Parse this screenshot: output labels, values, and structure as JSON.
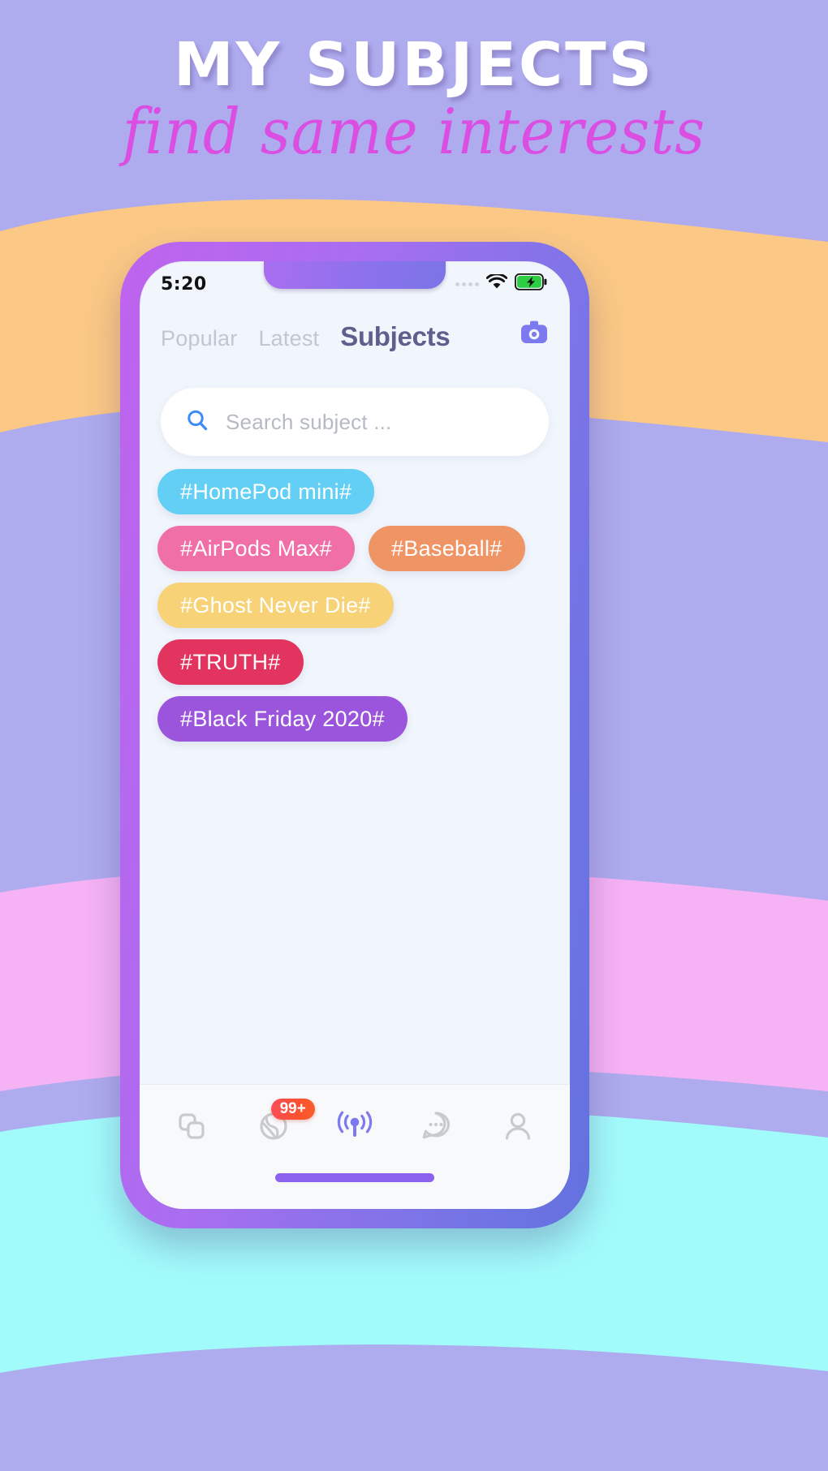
{
  "poster": {
    "title": "MY SUBJECTS",
    "subtitle": "find same interests",
    "title_color": "#ffffff",
    "subtitle_color": "#da4ee2",
    "background_base": "#aeabee",
    "wave_colors": [
      "#fbc985",
      "#f7b0f3",
      "#9bf7f7",
      "#b4b2f0"
    ]
  },
  "phone": {
    "frame_gradient_from": "#bf63ee",
    "frame_gradient_to": "#6272de",
    "screen_bg": "#f1f5fc"
  },
  "statusbar": {
    "time": "5:20",
    "signal_icon": "signal-dots-icon",
    "wifi_icon": "wifi-icon",
    "battery_icon": "battery-charging-icon",
    "battery_color": "#2ece44"
  },
  "topnav": {
    "tabs": [
      {
        "label": "Popular",
        "active": false
      },
      {
        "label": "Latest",
        "active": false
      },
      {
        "label": "Subjects",
        "active": true
      }
    ],
    "camera_icon": "camera-icon",
    "camera_color": "#7d7af0",
    "active_color": "#5f5f8e",
    "inactive_color": "#c2c6d2"
  },
  "search": {
    "icon": "search-icon",
    "icon_color": "#3d8bf5",
    "placeholder": "Search subject ...",
    "value": ""
  },
  "tags": [
    [
      {
        "label": "#HomePod mini#",
        "color": "#63cff4"
      }
    ],
    [
      {
        "label": "#AirPods Max#",
        "color": "#ef6fa6"
      },
      {
        "label": "#Baseball#",
        "color": "#ef9464"
      }
    ],
    [
      {
        "label": "#Ghost Never Die#",
        "color": "#f7d277"
      }
    ],
    [
      {
        "label": "#TRUTH#",
        "color": "#e2345e"
      }
    ],
    [
      {
        "label": "#Black Friday 2020#",
        "color": "#9b55dd"
      }
    ]
  ],
  "bottomnav": {
    "items": [
      {
        "icon": "copy-squares-icon",
        "active": false,
        "badge": ""
      },
      {
        "icon": "globe-icon",
        "active": false,
        "badge": "99+"
      },
      {
        "icon": "broadcast-icon",
        "active": true,
        "badge": ""
      },
      {
        "icon": "chat-bubble-icon",
        "active": false,
        "badge": ""
      },
      {
        "icon": "person-icon",
        "active": false,
        "badge": ""
      }
    ],
    "active_color": "#7d7af0",
    "inactive_color": "#c8cacd",
    "badge_color": "#fb4d4c"
  },
  "homebar": {
    "color": "#8b63ee"
  }
}
